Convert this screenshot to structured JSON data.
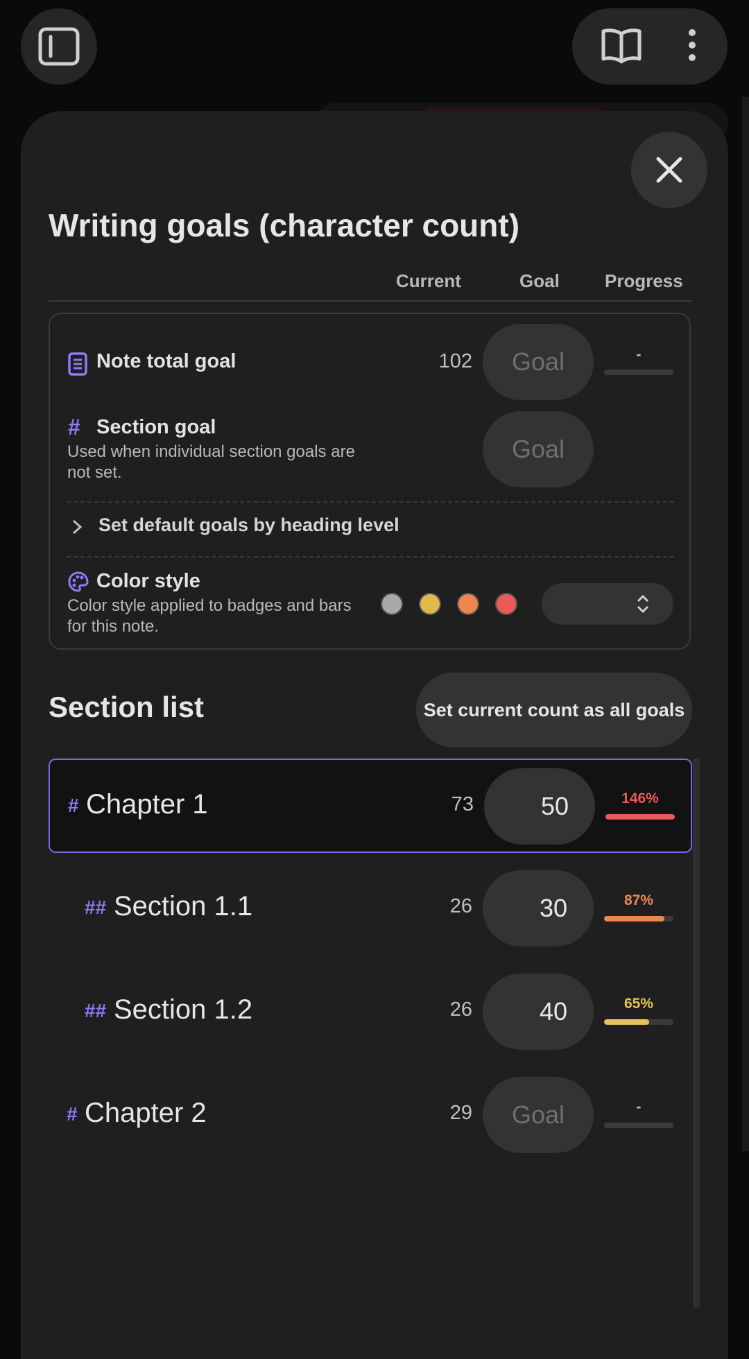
{
  "dialog": {
    "title": "Writing goals (character count)",
    "columns": {
      "current": "Current",
      "goal": "Goal",
      "progress": "Progress"
    }
  },
  "note_total": {
    "label": "Note total goal",
    "current": "102",
    "goal_placeholder": "Goal",
    "progress_text": "-"
  },
  "section_goal": {
    "label": "Section goal",
    "description": "Used when individual section goals are not set.",
    "goal_placeholder": "Goal"
  },
  "heading_defaults": {
    "label": "Set default goals by heading level"
  },
  "color_style": {
    "label": "Color style",
    "description": "Color style applied to badges and bars for this note.",
    "swatches": [
      "#a8a8a8",
      "#e1b84a",
      "#ee8650",
      "#ea5a58"
    ]
  },
  "section_list": {
    "title": "Section list",
    "set_all_button": "Set current count as all goals",
    "rows": [
      {
        "hash": "#",
        "label": "Chapter 1",
        "current": "73",
        "goal": "50",
        "progress_text": "146%",
        "progress": 1.0,
        "color": "#e85a5a",
        "selected": true
      },
      {
        "hash": "##",
        "label": "Section 1.1",
        "current": "26",
        "goal": "30",
        "progress_text": "87%",
        "progress": 0.87,
        "color": "#ee8650"
      },
      {
        "hash": "##",
        "label": "Section 1.2",
        "current": "26",
        "goal": "40",
        "progress_text": "65%",
        "progress": 0.65,
        "color": "#e6c25a"
      },
      {
        "hash": "#",
        "label": "Chapter 2",
        "current": "29",
        "goal": "Goal",
        "progress_text": "-",
        "progress": 0,
        "color": "#3a3a3a"
      }
    ]
  },
  "colors": {
    "accent": "#8b7cf6",
    "panel": "#1f1f1f",
    "background": "#0a0a0a"
  }
}
